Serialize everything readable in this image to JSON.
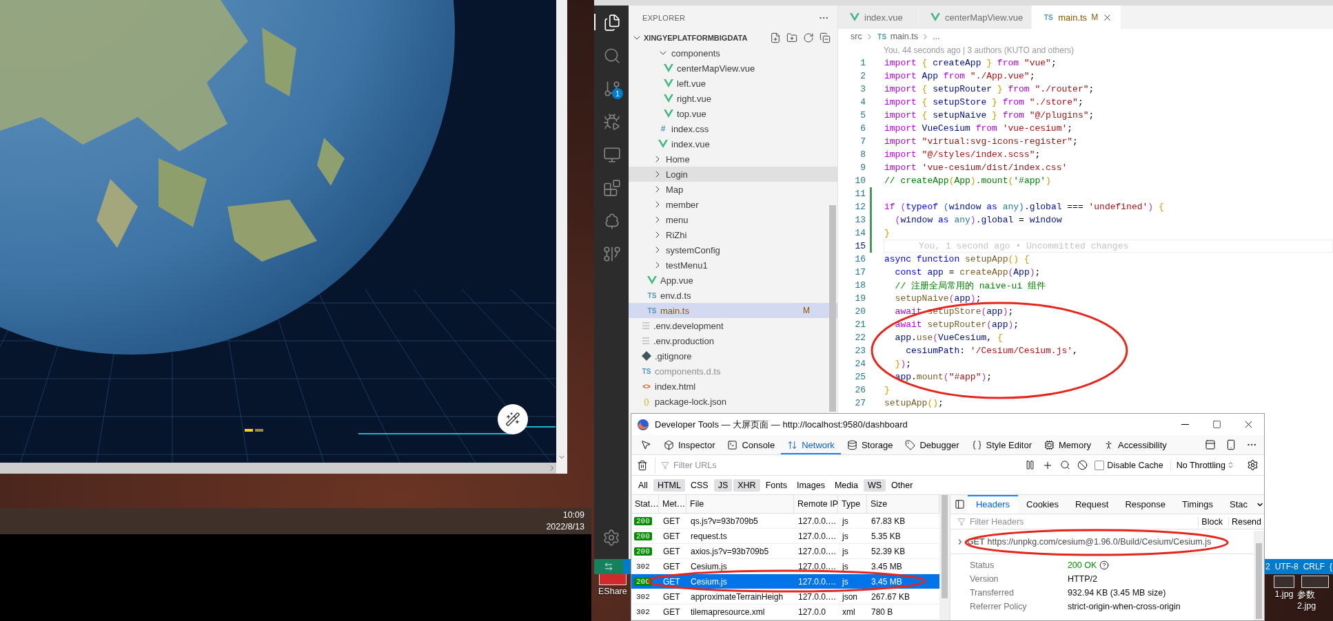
{
  "taskbar": {
    "time": "10:09",
    "date": "2022/8/13"
  },
  "desktop_icons": [
    {
      "label": "EShare",
      "kind": "shortcut"
    },
    {
      "label": "1.jpg",
      "kind": "image"
    },
    {
      "label": "参数2.jpg",
      "kind": "image"
    }
  ],
  "vscode": {
    "activity_bar": [
      {
        "kind": "files",
        "selected": true
      },
      {
        "kind": "search",
        "selected": false
      },
      {
        "kind": "source-control",
        "selected": false,
        "badge": "1"
      },
      {
        "kind": "run",
        "selected": false
      },
      {
        "kind": "remote",
        "selected": false
      },
      {
        "kind": "extensions",
        "selected": false
      },
      {
        "kind": "testing",
        "selected": false
      },
      {
        "kind": "git-graph",
        "selected": false
      }
    ],
    "explorer": {
      "title": "EXPLORER",
      "root": "XINGYEPLATFORMBIGDATA",
      "tree": [
        {
          "children": [
            {
              "children": [
                {
                  "children": [
                    {
                      "label": "components",
                      "kind": "folder",
                      "expanded": true,
                      "selected": false,
                      "children": [
                        {
                          "label": "centerMapView.vue",
                          "kind": "vue",
                          "selected": false
                        },
                        {
                          "label": "left.vue",
                          "kind": "vue",
                          "selected": false
                        },
                        {
                          "label": "right.vue",
                          "kind": "vue",
                          "selected": false
                        },
                        {
                          "label": "top.vue",
                          "kind": "vue",
                          "selected": false
                        }
                      ]
                    },
                    {
                      "label": "index.css",
                      "kind": "css",
                      "icon": "#",
                      "selected": false
                    },
                    {
                      "label": "index.vue",
                      "kind": "vue",
                      "selected": false
                    }
                  ]
                },
                {
                  "label": "Home",
                  "kind": "folder",
                  "expanded": false,
                  "selected": false
                },
                {
                  "label": "Login",
                  "kind": "folder",
                  "expanded": false,
                  "selected": false,
                  "hovered": true
                },
                {
                  "label": "Map",
                  "kind": "folder",
                  "expanded": false,
                  "selected": false
                },
                {
                  "label": "member",
                  "kind": "folder",
                  "expanded": false,
                  "selected": false
                },
                {
                  "label": "menu",
                  "kind": "folder",
                  "expanded": false,
                  "selected": false
                },
                {
                  "label": "RiZhi",
                  "kind": "folder",
                  "expanded": false,
                  "selected": false
                },
                {
                  "label": "systemConfig",
                  "kind": "folder",
                  "expanded": false,
                  "selected": false
                },
                {
                  "label": "testMenu1",
                  "kind": "folder",
                  "expanded": false,
                  "selected": false
                }
              ]
            },
            {
              "label": "App.vue",
              "kind": "vue",
              "selected": false
            },
            {
              "label": "env.d.ts",
              "kind": "ts",
              "icon": "TS",
              "selected": false
            },
            {
              "label": "main.ts",
              "kind": "ts",
              "icon": "TS",
              "selected": true,
              "git_status": "M"
            }
          ]
        },
        {
          "label": ".env.development",
          "kind": "env",
          "selected": false
        },
        {
          "label": ".env.production",
          "kind": "env",
          "selected": false
        },
        {
          "label": ".gitignore",
          "kind": "git",
          "selected": false
        },
        {
          "label": "components.d.ts",
          "kind": "ts",
          "icon": "TS",
          "selected": false,
          "dimmed": true
        },
        {
          "label": "index.html",
          "kind": "html",
          "icon": "<>",
          "selected": false
        },
        {
          "label": "package-lock.json",
          "kind": "json",
          "icon": "{}",
          "selected": false
        }
      ]
    },
    "tabs": [
      {
        "label": "index.vue",
        "kind": "vue",
        "selected": false
      },
      {
        "label": "centerMapView.vue",
        "kind": "vue",
        "selected": false
      },
      {
        "label": "main.ts",
        "kind": "ts",
        "icon": "TS",
        "selected": true,
        "git_status": "M"
      }
    ],
    "breadcrumb": [
      {
        "label": "src",
        "kind": "folder"
      },
      {
        "label": "main.ts",
        "kind": "ts",
        "icon": "TS"
      },
      {
        "label": "...",
        "kind": "symbol"
      }
    ],
    "blame_header": "You, 44 seconds ago | 3 authors (KUTO and others)",
    "code_lines": [
      {
        "number": "1",
        "changed": false,
        "current": false,
        "tokens": [
          {
            "kind": "kw",
            "text": "import "
          },
          {
            "kind": "b1",
            "text": "{ "
          },
          {
            "kind": "var",
            "text": "createApp "
          },
          {
            "kind": "b1",
            "text": "} "
          },
          {
            "kind": "kw",
            "text": "from "
          },
          {
            "kind": "str",
            "text": "\"vue\""
          },
          {
            "kind": "pl",
            "text": ";"
          }
        ]
      },
      {
        "number": "2",
        "changed": false,
        "current": false,
        "tokens": [
          {
            "kind": "kw",
            "text": "import "
          },
          {
            "kind": "var",
            "text": "App "
          },
          {
            "kind": "kw",
            "text": "from "
          },
          {
            "kind": "str",
            "text": "\"./App.vue\""
          },
          {
            "kind": "pl",
            "text": ";"
          }
        ]
      },
      {
        "number": "3",
        "changed": false,
        "current": false,
        "tokens": [
          {
            "kind": "kw",
            "text": "import "
          },
          {
            "kind": "b1",
            "text": "{ "
          },
          {
            "kind": "var",
            "text": "setupRouter "
          },
          {
            "kind": "b1",
            "text": "} "
          },
          {
            "kind": "kw",
            "text": "from "
          },
          {
            "kind": "str",
            "text": "\"./router\""
          },
          {
            "kind": "pl",
            "text": ";"
          }
        ]
      },
      {
        "number": "4",
        "changed": false,
        "current": false,
        "tokens": [
          {
            "kind": "kw",
            "text": "import "
          },
          {
            "kind": "b1",
            "text": "{ "
          },
          {
            "kind": "var",
            "text": "setupStore "
          },
          {
            "kind": "b1",
            "text": "} "
          },
          {
            "kind": "kw",
            "text": "from "
          },
          {
            "kind": "str",
            "text": "\"./store\""
          },
          {
            "kind": "pl",
            "text": ";"
          }
        ]
      },
      {
        "number": "5",
        "changed": false,
        "current": false,
        "tokens": [
          {
            "kind": "kw",
            "text": "import "
          },
          {
            "kind": "b1",
            "text": "{ "
          },
          {
            "kind": "var",
            "text": "setupNaive "
          },
          {
            "kind": "b1",
            "text": "} "
          },
          {
            "kind": "kw",
            "text": "from "
          },
          {
            "kind": "str",
            "text": "\"@/plugins\""
          },
          {
            "kind": "pl",
            "text": ";"
          }
        ]
      },
      {
        "number": "6",
        "changed": false,
        "current": false,
        "tokens": [
          {
            "kind": "kw",
            "text": "import "
          },
          {
            "kind": "var",
            "text": "VueCesium "
          },
          {
            "kind": "kw",
            "text": "from "
          },
          {
            "kind": "str",
            "text": "'vue-cesium'"
          },
          {
            "kind": "pl",
            "text": ";"
          }
        ]
      },
      {
        "number": "7",
        "changed": false,
        "current": false,
        "tokens": [
          {
            "kind": "kw",
            "text": "import "
          },
          {
            "kind": "str",
            "text": "\"virtual:svg-icons-register\""
          },
          {
            "kind": "pl",
            "text": ";"
          }
        ]
      },
      {
        "number": "8",
        "changed": false,
        "current": false,
        "tokens": [
          {
            "kind": "kw",
            "text": "import "
          },
          {
            "kind": "str",
            "text": "\"@/styles/index.scss\""
          },
          {
            "kind": "pl",
            "text": ";"
          }
        ]
      },
      {
        "number": "9",
        "changed": false,
        "current": false,
        "tokens": [
          {
            "kind": "kw",
            "text": "import "
          },
          {
            "kind": "str",
            "text": "'vue-cesium/dist/index.css'"
          }
        ]
      },
      {
        "number": "10",
        "changed": false,
        "current": false,
        "tokens": [
          {
            "kind": "cm",
            "text": "// createApp"
          },
          {
            "kind": "b1",
            "text": "("
          },
          {
            "kind": "cm",
            "text": "App"
          },
          {
            "kind": "b1",
            "text": ")"
          },
          {
            "kind": "cm",
            "text": ".mount"
          },
          {
            "kind": "b1",
            "text": "("
          },
          {
            "kind": "cm",
            "text": "'#app'"
          },
          {
            "kind": "b1",
            "text": ")"
          }
        ]
      },
      {
        "number": "11",
        "changed": true,
        "current": false
      },
      {
        "number": "12",
        "changed": true,
        "current": false,
        "tokens": [
          {
            "kind": "kw",
            "text": "if "
          },
          {
            "kind": "b2",
            "text": "("
          },
          {
            "kind": "st",
            "text": "typeof "
          },
          {
            "kind": "b3",
            "text": "("
          },
          {
            "kind": "var",
            "text": "window "
          },
          {
            "kind": "st",
            "text": "as "
          },
          {
            "kind": "ty",
            "text": "any"
          },
          {
            "kind": "b3",
            "text": ")"
          },
          {
            "kind": "var",
            "text": ".global "
          },
          {
            "kind": "pl",
            "text": "=== "
          },
          {
            "kind": "str",
            "text": "'undefined'"
          },
          {
            "kind": "b2",
            "text": ") "
          },
          {
            "kind": "b1",
            "text": "{"
          }
        ]
      },
      {
        "number": "13",
        "changed": true,
        "current": false,
        "tokens": [
          {
            "kind": "b2",
            "text": "  ("
          },
          {
            "kind": "var",
            "text": "window "
          },
          {
            "kind": "st",
            "text": "as "
          },
          {
            "kind": "ty",
            "text": "any"
          },
          {
            "kind": "b2",
            "text": ")"
          },
          {
            "kind": "var",
            "text": ".global "
          },
          {
            "kind": "pl",
            "text": "= "
          },
          {
            "kind": "var",
            "text": "window"
          }
        ]
      },
      {
        "number": "14",
        "changed": true,
        "current": false,
        "tokens": [
          {
            "kind": "b1",
            "text": "}"
          }
        ]
      },
      {
        "number": "15",
        "changed": true,
        "current": true,
        "blame": "You, 1 second ago • Uncommitted changes"
      },
      {
        "number": "16",
        "changed": false,
        "current": false,
        "tokens": [
          {
            "kind": "st",
            "text": "async function "
          },
          {
            "kind": "fn",
            "text": "setupApp"
          },
          {
            "kind": "b1",
            "text": "() {"
          }
        ]
      },
      {
        "number": "17",
        "changed": false,
        "current": false,
        "tokens": [
          {
            "kind": "st",
            "text": "  const "
          },
          {
            "kind": "var",
            "text": "app "
          },
          {
            "kind": "pl",
            "text": "= "
          },
          {
            "kind": "fn",
            "text": "createApp"
          },
          {
            "kind": "b2",
            "text": "("
          },
          {
            "kind": "var",
            "text": "App"
          },
          {
            "kind": "b2",
            "text": ")"
          },
          {
            "kind": "pl",
            "text": ";"
          }
        ]
      },
      {
        "number": "18",
        "changed": false,
        "current": false,
        "tokens": [
          {
            "kind": "cm",
            "text": "  // 注册全局常用的 naive-ui 组件"
          }
        ]
      },
      {
        "number": "19",
        "changed": false,
        "current": false,
        "tokens": [
          {
            "kind": "fn",
            "text": "  setupNaive"
          },
          {
            "kind": "b2",
            "text": "("
          },
          {
            "kind": "var",
            "text": "app"
          },
          {
            "kind": "b2",
            "text": ")"
          },
          {
            "kind": "pl",
            "text": ";"
          }
        ]
      },
      {
        "number": "20",
        "changed": false,
        "current": false,
        "tokens": [
          {
            "kind": "kw",
            "text": "  await "
          },
          {
            "kind": "fn",
            "text": "setupStore"
          },
          {
            "kind": "b2",
            "text": "("
          },
          {
            "kind": "var",
            "text": "app"
          },
          {
            "kind": "b2",
            "text": ")"
          },
          {
            "kind": "pl",
            "text": ";"
          }
        ]
      },
      {
        "number": "21",
        "changed": false,
        "current": false,
        "tokens": [
          {
            "kind": "kw",
            "text": "  await "
          },
          {
            "kind": "fn",
            "text": "setupRouter"
          },
          {
            "kind": "b2",
            "text": "("
          },
          {
            "kind": "var",
            "text": "app"
          },
          {
            "kind": "b2",
            "text": ")"
          },
          {
            "kind": "pl",
            "text": ";"
          }
        ]
      },
      {
        "number": "22",
        "changed": false,
        "current": false,
        "tokens": [
          {
            "kind": "var",
            "text": "  app"
          },
          {
            "kind": "pl",
            "text": "."
          },
          {
            "kind": "fn",
            "text": "use"
          },
          {
            "kind": "b2",
            "text": "("
          },
          {
            "kind": "var",
            "text": "VueCesium"
          },
          {
            "kind": "pl",
            "text": ", "
          },
          {
            "kind": "b1",
            "text": "{"
          }
        ]
      },
      {
        "number": "23",
        "changed": false,
        "current": false,
        "tokens": [
          {
            "kind": "var",
            "text": "    cesiumPath"
          },
          {
            "kind": "pl",
            "text": ": "
          },
          {
            "kind": "str",
            "text": "'/Cesium/Cesium.js'"
          },
          {
            "kind": "pl",
            "text": ","
          }
        ]
      },
      {
        "number": "24",
        "changed": false,
        "current": false,
        "tokens": [
          {
            "kind": "b1",
            "text": "  }"
          },
          {
            "kind": "b2",
            "text": ")"
          },
          {
            "kind": "pl",
            "text": ";"
          }
        ]
      },
      {
        "number": "25",
        "changed": false,
        "current": false,
        "tokens": [
          {
            "kind": "var",
            "text": "  app"
          },
          {
            "kind": "pl",
            "text": "."
          },
          {
            "kind": "fn",
            "text": "mount"
          },
          {
            "kind": "b2",
            "text": "("
          },
          {
            "kind": "str",
            "text": "\"#app\""
          },
          {
            "kind": "b2",
            "text": ")"
          },
          {
            "kind": "pl",
            "text": ";"
          }
        ]
      },
      {
        "number": "26",
        "changed": false,
        "current": false,
        "tokens": [
          {
            "kind": "b1",
            "text": "}"
          }
        ]
      },
      {
        "number": "27",
        "changed": false,
        "current": false,
        "tokens": [
          {
            "kind": "fn",
            "text": "setupApp"
          },
          {
            "kind": "b1",
            "text": "()"
          },
          {
            "kind": "pl",
            "text": ";"
          }
        ]
      }
    ],
    "status_bar": {
      "items": [
        "2",
        "UTF-8",
        "CRLF",
        "{"
      ]
    }
  },
  "devtools": {
    "title": "Developer Tools — 大屏页面 — http://localhost:9580/dashboard",
    "tools": [
      {
        "label": "Inspector",
        "kind": "inspector",
        "selected": false
      },
      {
        "label": "Console",
        "kind": "console",
        "selected": false
      },
      {
        "label": "Network",
        "kind": "network",
        "selected": true
      },
      {
        "label": "Storage",
        "kind": "storage",
        "selected": false
      },
      {
        "label": "Debugger",
        "kind": "debugger",
        "selected": false
      },
      {
        "label": "Style Editor",
        "kind": "style",
        "selected": false
      },
      {
        "label": "Memory",
        "kind": "memory",
        "selected": false
      },
      {
        "label": "Accessibility",
        "kind": "accessibility",
        "selected": false
      }
    ],
    "url_filter": {
      "placeholder": "Filter URLs"
    },
    "disable_cache": {
      "label": "Disable Cache",
      "checked": false
    },
    "throttling": "No Throttling",
    "type_filters": [
      {
        "label": "All",
        "selected": false
      },
      {
        "label": "HTML",
        "selected": true
      },
      {
        "label": "CSS",
        "selected": false
      },
      {
        "label": "JS",
        "selected": true
      },
      {
        "label": "XHR",
        "selected": true
      },
      {
        "label": "Fonts",
        "selected": false
      },
      {
        "label": "Images",
        "selected": false
      },
      {
        "label": "Media",
        "selected": false
      },
      {
        "label": "WS",
        "selected": true
      },
      {
        "label": "Other",
        "selected": false
      }
    ],
    "columns": [
      "Stat…",
      "Met…",
      "File",
      "Remote IP",
      "Type",
      "Size"
    ],
    "requests": [
      {
        "status": "200",
        "kind": "success",
        "method": "GET",
        "file": "qs.js?v=93b709b5",
        "remote_ip": "127.0.0.…",
        "type": "js",
        "size": "67.83 KB",
        "selected": false
      },
      {
        "status": "200",
        "kind": "success",
        "method": "GET",
        "file": "request.ts",
        "remote_ip": "127.0.0.…",
        "type": "js",
        "size": "5.35 KB",
        "selected": false
      },
      {
        "status": "200",
        "kind": "success",
        "method": "GET",
        "file": "axios.js?v=93b709b5",
        "remote_ip": "127.0.0.…",
        "type": "js",
        "size": "52.39 KB",
        "selected": false
      },
      {
        "status": "302",
        "kind": "redirect",
        "method": "GET",
        "file": "Cesium.js",
        "remote_ip": "127.0.0.…",
        "type": "js",
        "size": "3.45 MB",
        "selected": false
      },
      {
        "status": "200",
        "kind": "success",
        "method": "GET",
        "file": "Cesium.js",
        "remote_ip": "127.0.0.…",
        "type": "js",
        "size": "3.45 MB",
        "selected": true
      },
      {
        "status": "302",
        "kind": "redirect",
        "method": "GET",
        "file": "approximateTerrainHeigh",
        "remote_ip": "127.0.0.…",
        "type": "json",
        "size": "267.67 KB",
        "selected": false
      },
      {
        "status": "302",
        "kind": "redirect",
        "method": "GET",
        "file": "tilemapresource.xml",
        "remote_ip": "127.0.0",
        "type": "xml",
        "size": "780 B",
        "selected": false
      }
    ],
    "details": {
      "tabs": [
        {
          "label": "Headers",
          "selected": true
        },
        {
          "label": "Cookies",
          "selected": false
        },
        {
          "label": "Request",
          "selected": false
        },
        {
          "label": "Response",
          "selected": false
        },
        {
          "label": "Timings",
          "selected": false
        },
        {
          "label": "Stac",
          "selected": false
        }
      ],
      "filter": {
        "placeholder": "Filter Headers"
      },
      "buttons": [
        "Block",
        "Resend"
      ],
      "method": "GET",
      "url": "https://unpkg.com/cesium@1.96.0/Build/Cesium/Cesium.js",
      "fields": [
        {
          "label": "Status",
          "value": "200 OK",
          "kind": "status"
        },
        {
          "label": "Version",
          "value": "HTTP/2",
          "kind": "text"
        },
        {
          "label": "Transferred",
          "value": "932.94 KB (3.45 MB size)",
          "kind": "text"
        },
        {
          "label": "Referrer Policy",
          "value": "strict-origin-when-cross-origin",
          "kind": "text"
        }
      ]
    }
  }
}
